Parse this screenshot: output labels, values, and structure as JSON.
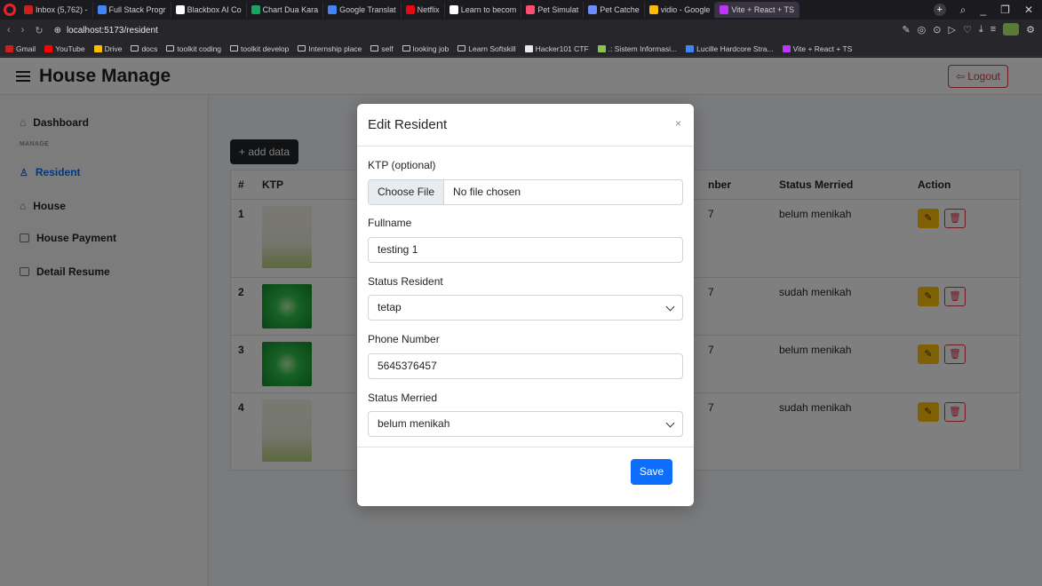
{
  "browser": {
    "tabs": [
      {
        "label": "Inbox (5,762) -",
        "color": "#c5221f"
      },
      {
        "label": "Full Stack Progr",
        "color": "#4285f4"
      },
      {
        "label": "Blackbox AI Co",
        "color": "#ffffff"
      },
      {
        "label": "Chart Dua Kara",
        "color": "#1aa260"
      },
      {
        "label": "Google Translat",
        "color": "#4285f4"
      },
      {
        "label": "Netflix",
        "color": "#e50914"
      },
      {
        "label": "Learn to becom",
        "color": "#ffffff"
      },
      {
        "label": "Pet Simulat",
        "color": "#ff4d6d"
      },
      {
        "label": "Pet Catche",
        "color": "#6c8cff"
      },
      {
        "label": "vidio - Google",
        "color": "#fbbc04"
      },
      {
        "label": "Vite + React + TS",
        "color": "#bd34fe"
      }
    ],
    "url": "localhost:5173/resident",
    "bookmarks": [
      {
        "label": "Gmail",
        "kind": "icon",
        "color": "#c5221f"
      },
      {
        "label": "YouTube",
        "kind": "icon",
        "color": "#ff0000"
      },
      {
        "label": "Drive",
        "kind": "icon",
        "color": "#fbbc04"
      },
      {
        "label": "docs",
        "kind": "folder"
      },
      {
        "label": "toolkit coding",
        "kind": "folder"
      },
      {
        "label": "toolkit develop",
        "kind": "folder"
      },
      {
        "label": "Internship place",
        "kind": "folder"
      },
      {
        "label": "self",
        "kind": "folder"
      },
      {
        "label": "looking job",
        "kind": "folder"
      },
      {
        "label": "Learn Softskill",
        "kind": "folder"
      },
      {
        "label": "Hacker101 CTF",
        "kind": "icon",
        "color": "#e8e8ec"
      },
      {
        "label": ".: Sistem Informasi...",
        "kind": "icon",
        "color": "#8bc34a"
      },
      {
        "label": "Lucille Hardcore Stra...",
        "kind": "icon",
        "color": "#4285f4"
      },
      {
        "label": "Vite + React + TS",
        "kind": "icon",
        "color": "#bd34fe"
      }
    ]
  },
  "app": {
    "brand": "House Manage",
    "logout_label": "Logout",
    "sidebar": {
      "dashboard": "Dashboard",
      "section": "MANAGE",
      "resident": "Resident",
      "house": "House",
      "house_payment": "House Payment",
      "detail_resume": "Detail Resume"
    },
    "add_label": "+ add data",
    "table": {
      "headers": {
        "num": "#",
        "ktp": "KTP",
        "phone": "nber",
        "status": "Status Merried",
        "action": "Action"
      },
      "rows": [
        {
          "num": "1",
          "phone": "7",
          "status": "belum menikah",
          "ktp": "menu"
        },
        {
          "num": "2",
          "phone": "7",
          "status": "sudah menikah",
          "ktp": "green"
        },
        {
          "num": "3",
          "phone": "7",
          "status": "belum menikah",
          "ktp": "green"
        },
        {
          "num": "4",
          "phone": "7",
          "status": "sudah menikah",
          "ktp": "menu"
        }
      ]
    }
  },
  "modal": {
    "title": "Edit Resident",
    "close": "×",
    "ktp_label": "KTP (optional)",
    "file_button": "Choose File",
    "file_status": "No file chosen",
    "fullname_label": "Fullname",
    "fullname_value": "testing 1",
    "status_resident_label": "Status Resident",
    "status_resident_value": "tetap",
    "phone_label": "Phone Number",
    "phone_value": "5645376457",
    "status_merried_label": "Status Merried",
    "status_merried_value": "belum menikah",
    "save_label": "Save"
  }
}
